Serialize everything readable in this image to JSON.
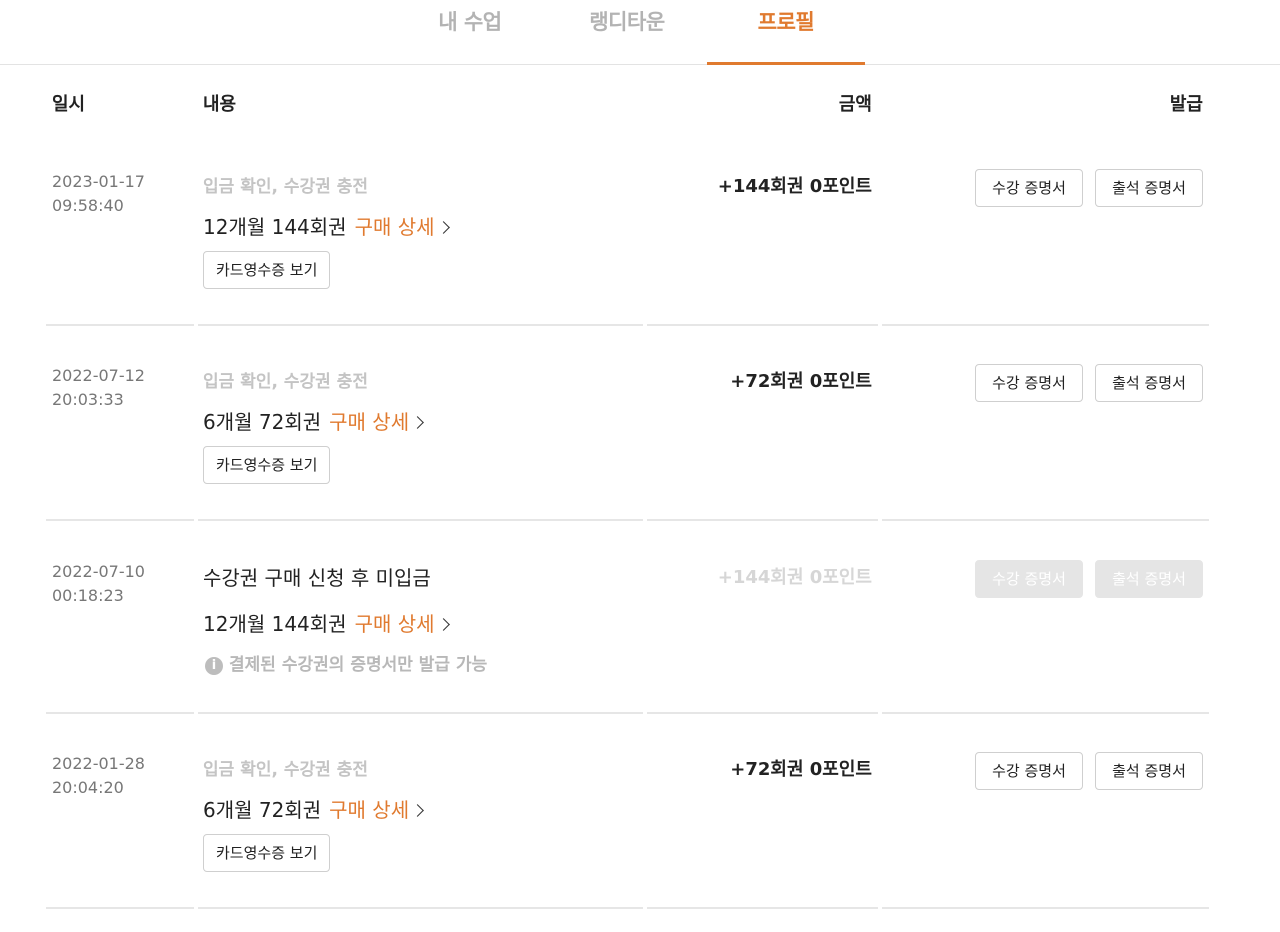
{
  "tabs": [
    {
      "label": "내 수업",
      "active": false
    },
    {
      "label": "랭디타운",
      "active": false
    },
    {
      "label": "프로필",
      "active": true
    }
  ],
  "accent_color": "#e07a2f",
  "table": {
    "headers": {
      "date": "일시",
      "content": "내용",
      "amount": "금액",
      "issue": "발급"
    },
    "rows": [
      {
        "date": "2023-01-17",
        "time": "09:58:40",
        "status": "입금 확인, 수강권 충전",
        "product": "12개월 144회권",
        "detail_label": "구매 상세",
        "receipt_label": "카드영수증 보기",
        "amount": "+144회권 0포인트",
        "cert_course": "수강 증명서",
        "cert_attendance": "출석 증명서",
        "enabled": true
      },
      {
        "date": "2022-07-12",
        "time": "20:03:33",
        "status": "입금 확인, 수강권 충전",
        "product": "6개월 72회권",
        "detail_label": "구매 상세",
        "receipt_label": "카드영수증 보기",
        "amount": "+72회권 0포인트",
        "cert_course": "수강 증명서",
        "cert_attendance": "출석 증명서",
        "enabled": true
      },
      {
        "date": "2022-07-10",
        "time": "00:18:23",
        "status": "수강권 구매 신청 후 미입금",
        "product": "12개월 144회권",
        "detail_label": "구매 상세",
        "note": "결제된 수강권의 증명서만 발급 가능",
        "amount": "+144회권 0포인트",
        "cert_course": "수강 증명서",
        "cert_attendance": "출석 증명서",
        "enabled": false
      },
      {
        "date": "2022-01-28",
        "time": "20:04:20",
        "status": "입금 확인, 수강권 충전",
        "product": "6개월 72회권",
        "detail_label": "구매 상세",
        "receipt_label": "카드영수증 보기",
        "amount": "+72회권 0포인트",
        "cert_course": "수강 증명서",
        "cert_attendance": "출석 증명서",
        "enabled": true
      }
    ]
  }
}
